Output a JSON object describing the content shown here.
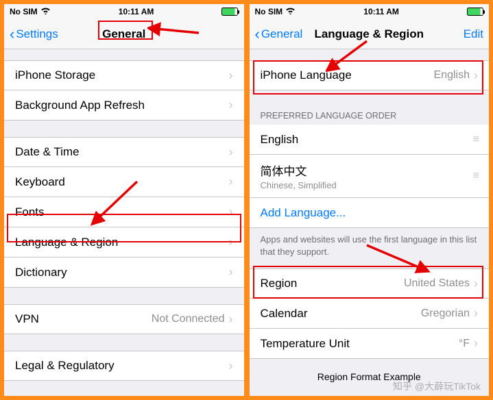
{
  "status": {
    "carrier": "No SIM",
    "time": "10:11 AM"
  },
  "left": {
    "back": "Settings",
    "title": "General",
    "rows": {
      "storage": "iPhone Storage",
      "bgRefresh": "Background App Refresh",
      "dateTime": "Date & Time",
      "keyboard": "Keyboard",
      "fonts": "Fonts",
      "langRegion": "Language & Region",
      "dictionary": "Dictionary",
      "vpn": "VPN",
      "vpnValue": "Not Connected",
      "legal": "Legal & Regulatory"
    }
  },
  "right": {
    "back": "General",
    "title": "Language & Region",
    "edit": "Edit",
    "iphoneLang": "iPhone Language",
    "iphoneLangValue": "English",
    "prefHeader": "PREFERRED LANGUAGE ORDER",
    "lang1": "English",
    "lang2": "简体中文",
    "lang2Sub": "Chinese, Simplified",
    "addLang": "Add Language...",
    "prefFooter": "Apps and websites will use the first language in this list that they support.",
    "region": "Region",
    "regionValue": "United States",
    "calendar": "Calendar",
    "calendarValue": "Gregorian",
    "tempUnit": "Temperature Unit",
    "tempValue": "°F",
    "exampleHeader": "Region Format Example"
  },
  "watermark": "知乎 @大薛玩TikTok"
}
